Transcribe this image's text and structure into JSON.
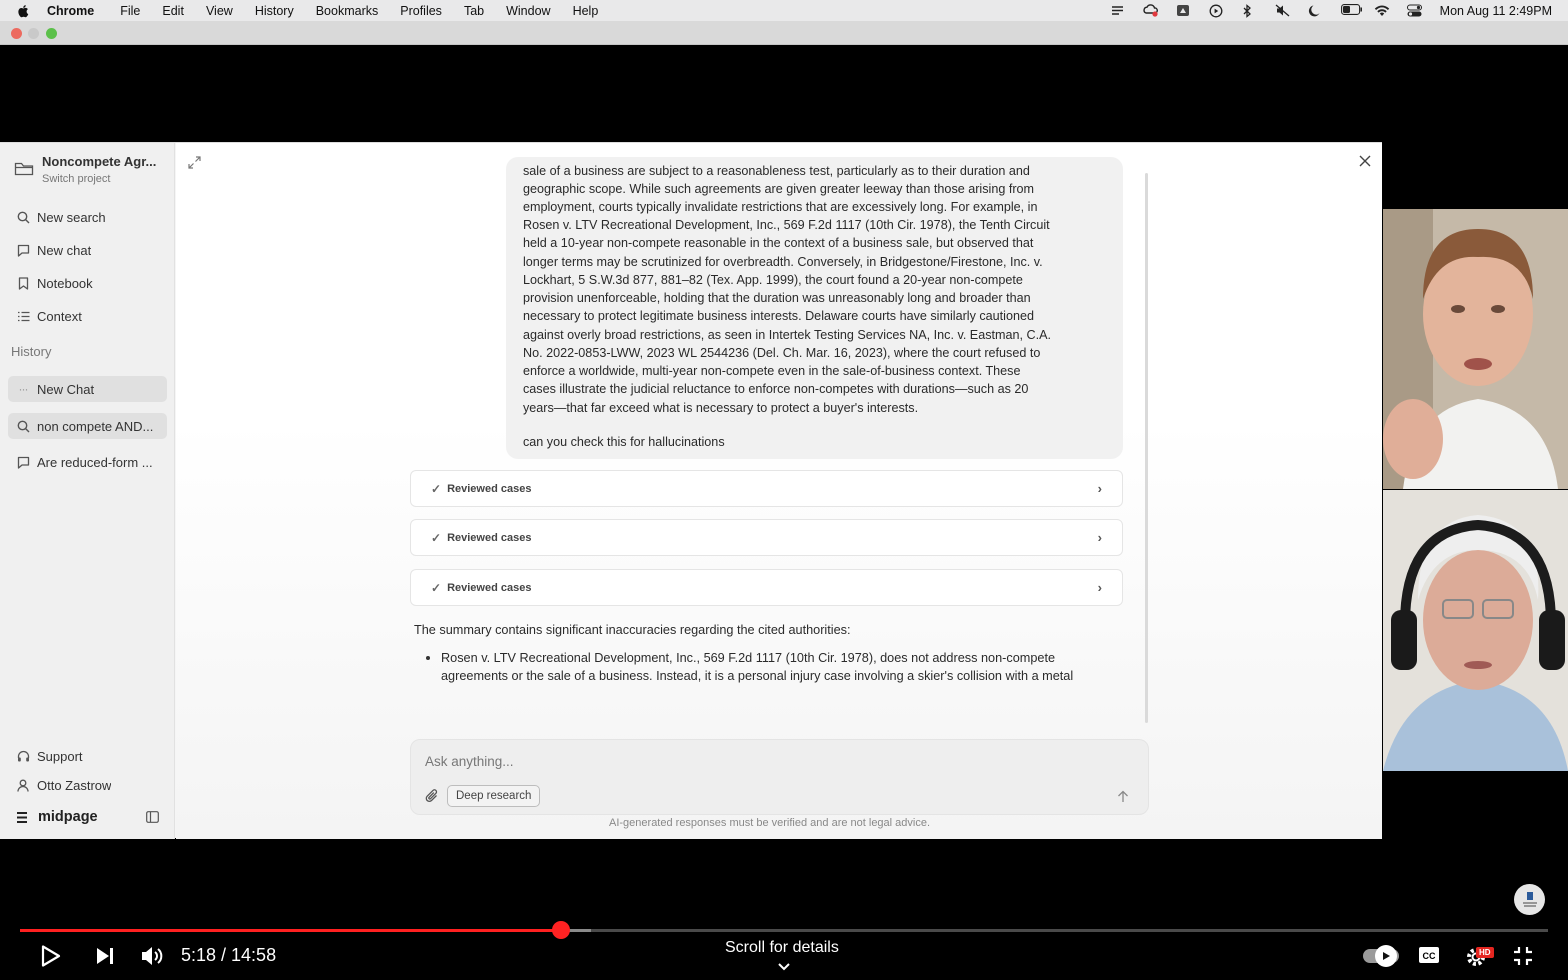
{
  "menubar": {
    "app_name": "Chrome",
    "items": [
      "File",
      "Edit",
      "View",
      "History",
      "Bookmarks",
      "Profiles",
      "Tab",
      "Window",
      "Help"
    ],
    "clock": "Mon Aug 11  2:49PM"
  },
  "sidebar": {
    "project_name": "Noncompete Agr...",
    "project_sub": "Switch project",
    "nav": [
      {
        "label": "New search",
        "icon": "search-icon"
      },
      {
        "label": "New chat",
        "icon": "chat-icon"
      },
      {
        "label": "Notebook",
        "icon": "bookmark-icon"
      },
      {
        "label": "Context",
        "icon": "list-icon"
      }
    ],
    "history_heading": "History",
    "history": [
      {
        "label": "New Chat",
        "icon": "dots-icon"
      },
      {
        "label": "non compete AND...",
        "icon": "search-icon"
      },
      {
        "label": "Are reduced-form ...",
        "icon": "chat-icon"
      }
    ],
    "support": "Support",
    "user": "Otto Zastrow",
    "brand": "midpage"
  },
  "chat": {
    "user_message_lines": [
      "sale of a business are subject to a reasonableness test, particularly as to their duration and",
      "geographic scope. While such agreements are given greater leeway than those arising from",
      "employment, courts typically invalidate restrictions that are excessively long. For example, in",
      "Rosen v. LTV Recreational Development, Inc., 569 F.2d 1117 (10th Cir. 1978), the Tenth Circuit",
      "held a 10-year non-compete reasonable in the context of a business sale, but observed that",
      "longer terms may be scrutinized for overbreadth. Conversely, in Bridgestone/Firestone, Inc. v.",
      "Lockhart, 5 S.W.3d 877, 881–82 (Tex. App. 1999), the court found a 20-year non-compete",
      "provision unenforceable, holding that the duration was unreasonably long and broader than",
      "necessary to protect legitimate business interests. Delaware courts have similarly cautioned",
      "against overly broad restrictions, as seen in Intertek Testing Services NA, Inc. v. Eastman, C.A.",
      "No. 2022-0853-LWW, 2023 WL 2544236 (Del. Ch. Mar. 16, 2023), where the court refused to",
      "enforce a worldwide, multi-year non-compete even in the sale-of-business context. These",
      "cases illustrate the judicial reluctance to enforce non-competes with durations—such as 20",
      "years—that far exceed what is necessary to protect a buyer's interests."
    ],
    "user_question": "can you check this for hallucinations",
    "reviews": [
      "Reviewed cases",
      "Reviewed cases",
      "Reviewed cases"
    ],
    "response_intro": "The summary contains significant inaccuracies regarding the cited authorities:",
    "bullet_line1": "Rosen v. LTV Recreational Development, Inc., 569 F.2d 1117 (10th Cir. 1978), does not address non-compete",
    "bullet_line2": "agreements or the sale of a business. Instead, it is a personal injury case involving a skier's collision with a metal",
    "input_placeholder": "Ask anything...",
    "deep_research": "Deep research",
    "disclaimer": "AI-generated responses must be verified and are not legal advice."
  },
  "player": {
    "time": "5:18 / 14:58",
    "scroll_hint": "Scroll for details",
    "progress_played": 0.354,
    "progress_buffered": 0.374,
    "hd_badge": "HD"
  }
}
